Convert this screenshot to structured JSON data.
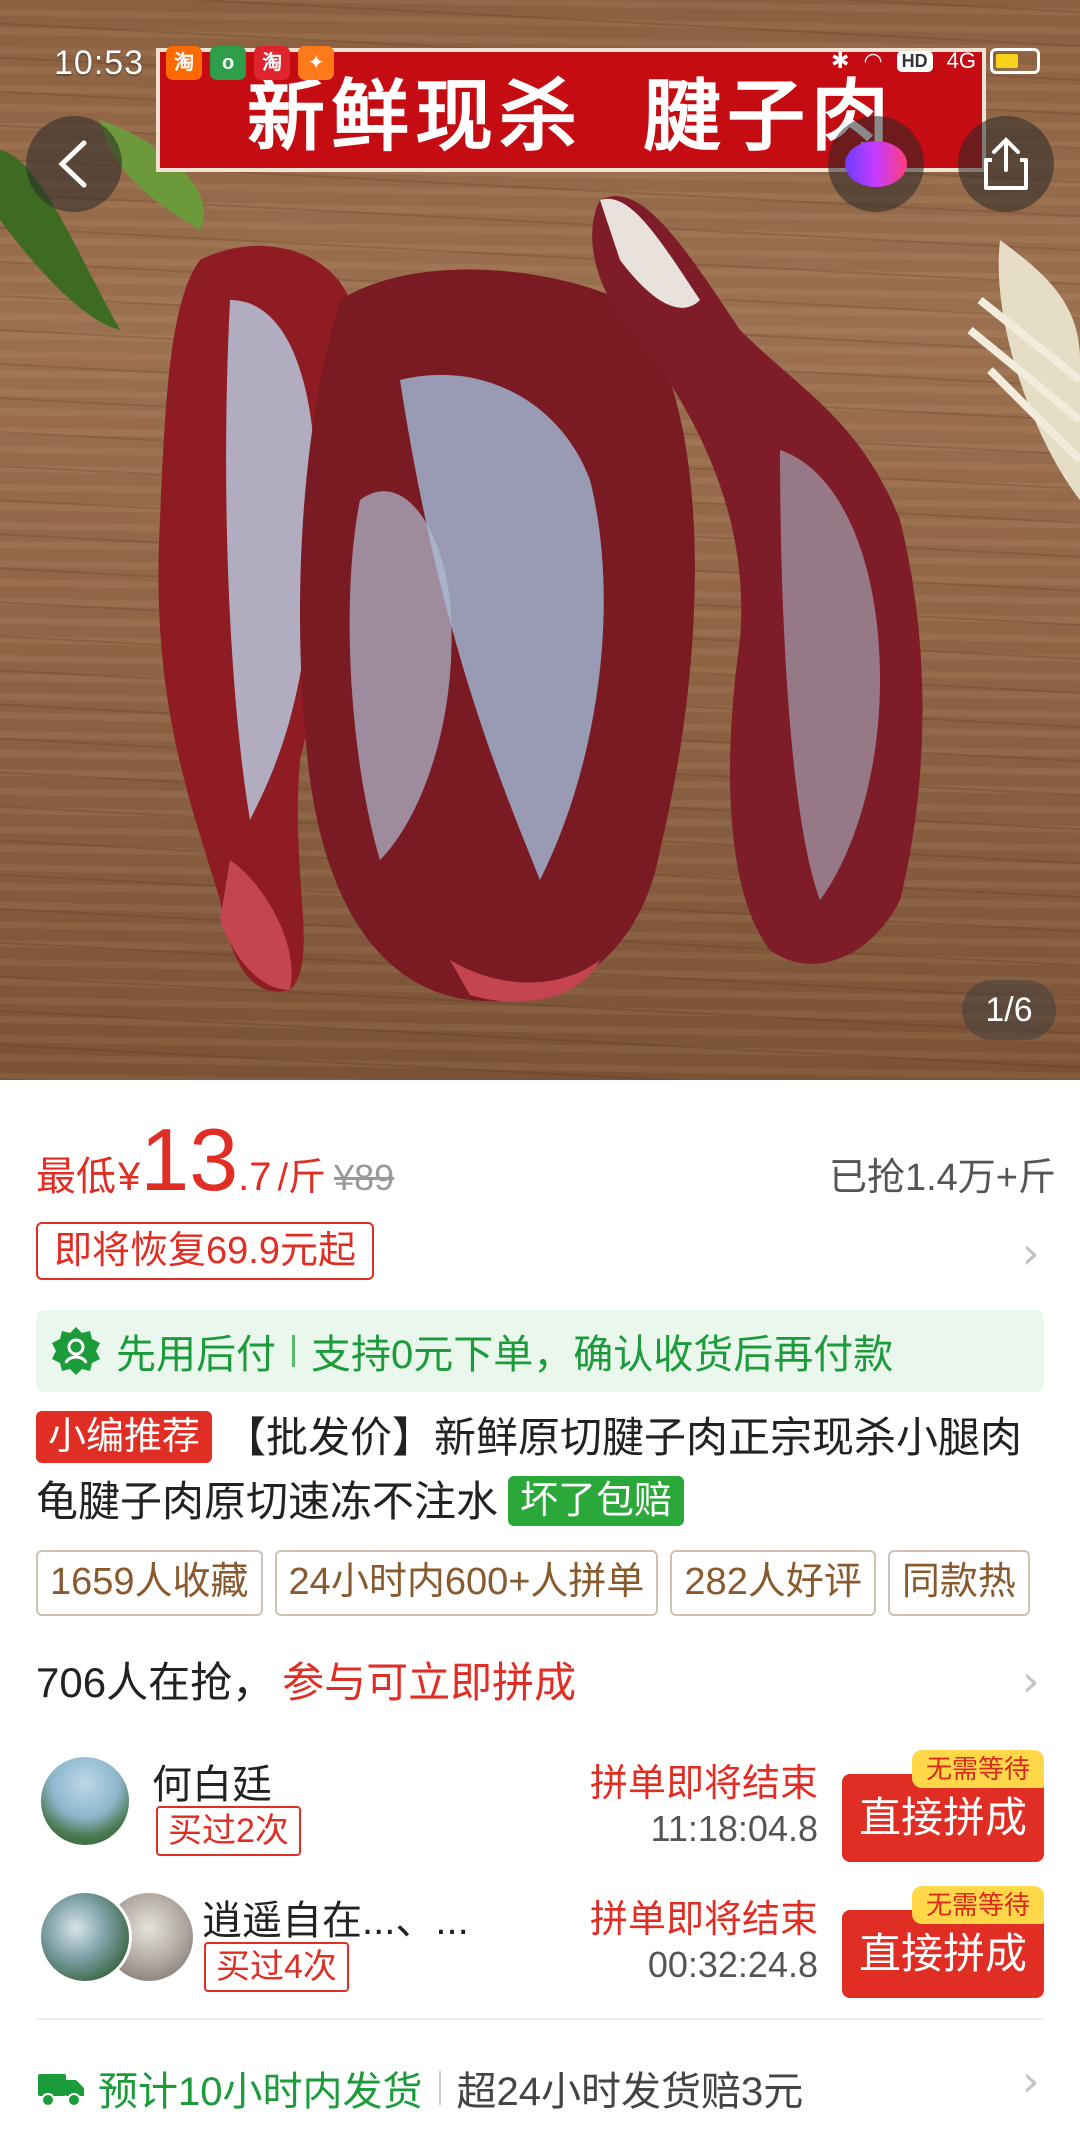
{
  "status_bar": {
    "time": "10:53",
    "network": "4G",
    "hd": "HD"
  },
  "hero": {
    "banner_left": "新鲜现杀",
    "banner_right": "腱子肉",
    "page_indicator": "1/6"
  },
  "price": {
    "label": "最低",
    "currency": "¥",
    "integer": "13",
    "decimal": ".7",
    "unit": "/斤",
    "original": "¥89",
    "sold": "已抢1.4万+斤"
  },
  "restore_notice": "即将恢复69.9元起",
  "pay_later": {
    "title": "先用后付",
    "desc": "支持0元下单，确认收货后再付款"
  },
  "product": {
    "editor_badge": "小编推荐",
    "title": "【批发价】新鲜原切腱子肉正宗现杀小腿肉龟腱子肉原切速冻不注水",
    "guarantee_badge": "坏了包赔"
  },
  "stats": [
    "1659人收藏",
    "24小时内600+人拼单",
    "282人好评",
    "同款热"
  ],
  "group": {
    "count_text": "706人在抢，",
    "cta_text": "参与可立即拼成",
    "members": [
      {
        "name": "何白廷",
        "bought": "买过2次",
        "end_label": "拼单即将结束",
        "countdown": "11:18:04.8",
        "button": "直接拼成",
        "no_wait": "无需等待"
      },
      {
        "name": "逍遥自在...、...",
        "bought": "买过4次",
        "end_label": "拼单即将结束",
        "countdown": "00:32:24.8",
        "button": "直接拼成",
        "no_wait": "无需等待"
      }
    ]
  },
  "shipping": {
    "eta": "预计10小时内发货",
    "compensation": "超24小时发货赔3元"
  },
  "colors": {
    "accent_red": "#e02e24",
    "green": "#1c9b3a",
    "banner_red": "#c40c12"
  }
}
